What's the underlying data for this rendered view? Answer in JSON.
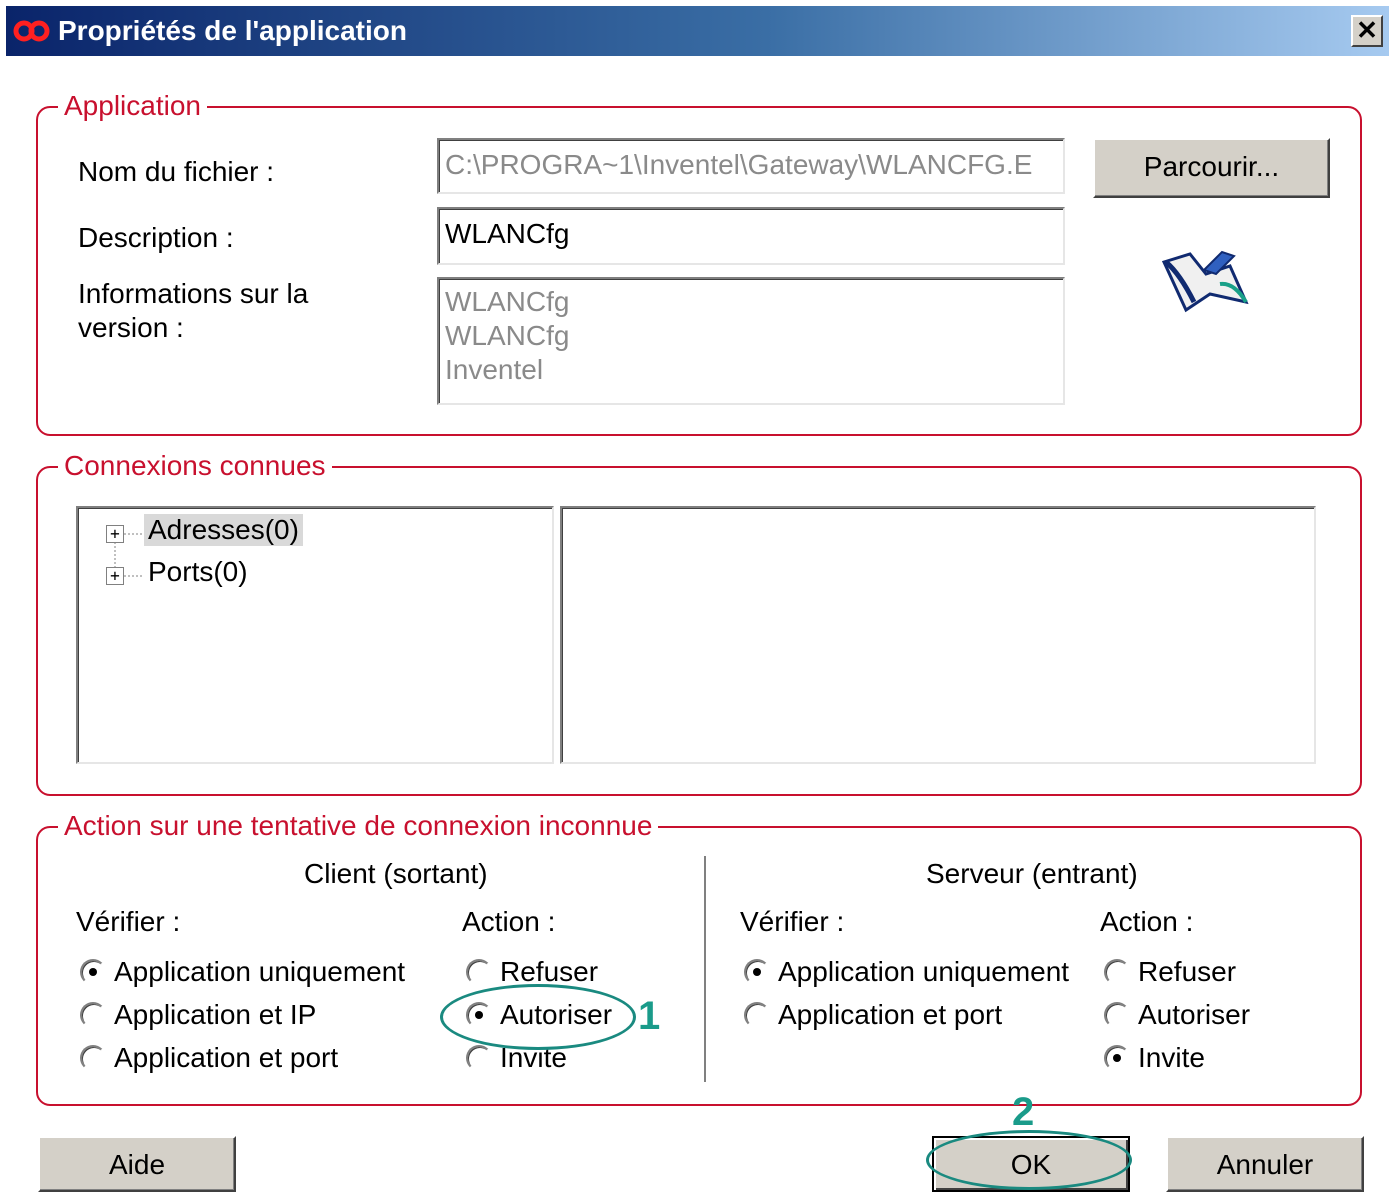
{
  "window": {
    "title": "Propriétés de l'application",
    "close_label": "✕"
  },
  "application": {
    "legend": "Application",
    "filename_label": "Nom du fichier :",
    "filename_value": "C:\\PROGRA~1\\Inventel\\Gateway\\WLANCFG.E",
    "browse_label": "Parcourir...",
    "description_label": "Description :",
    "description_value": "WLANCfg",
    "version_label_1": "Informations sur la",
    "version_label_2": "version :",
    "version_lines": [
      "WLANCfg",
      "WLANCfg",
      "Inventel"
    ]
  },
  "connections": {
    "legend": "Connexions connues",
    "tree": [
      {
        "label": "Adresses(0)",
        "selected": true
      },
      {
        "label": "Ports(0)",
        "selected": false
      }
    ]
  },
  "action": {
    "legend": "Action sur une tentative de connexion inconnue",
    "client": {
      "title": "Client (sortant)",
      "verify_label": "Vérifier :",
      "action_label": "Action :",
      "verify_options": [
        {
          "label": "Application uniquement",
          "checked": true
        },
        {
          "label": "Application et IP",
          "checked": false
        },
        {
          "label": "Application et port",
          "checked": false
        }
      ],
      "action_options": [
        {
          "label": "Refuser",
          "checked": false
        },
        {
          "label": "Autoriser",
          "checked": true
        },
        {
          "label": "Invite",
          "checked": false
        }
      ]
    },
    "server": {
      "title": "Serveur (entrant)",
      "verify_label": "Vérifier :",
      "action_label": "Action :",
      "verify_options": [
        {
          "label": "Application uniquement",
          "checked": true
        },
        {
          "label": "Application et port",
          "checked": false
        }
      ],
      "action_options": [
        {
          "label": "Refuser",
          "checked": false
        },
        {
          "label": "Autoriser",
          "checked": false
        },
        {
          "label": "Invite",
          "checked": true
        }
      ]
    }
  },
  "buttons": {
    "help": "Aide",
    "ok": "OK",
    "cancel": "Annuler"
  },
  "annotations": {
    "step1": "1",
    "step2": "2",
    "color": "#1a9b8a"
  },
  "colors": {
    "group_border": "#c8102e",
    "title_gradient_start": "#0a246a",
    "button_face": "#d4d0c8"
  }
}
